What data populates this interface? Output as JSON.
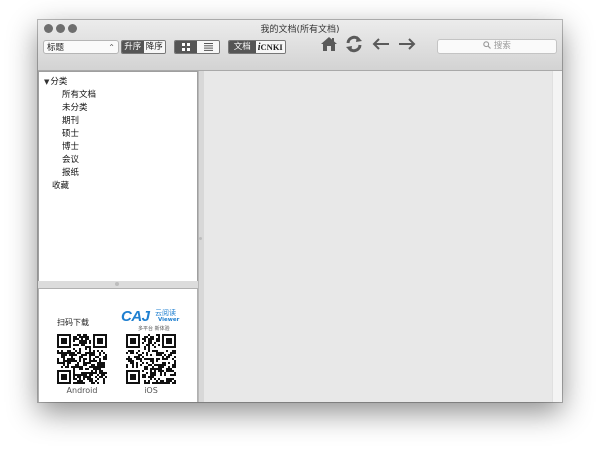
{
  "window": {
    "title": "我的文档(所有文档)"
  },
  "toolbar": {
    "sort_field": "标题",
    "sort_order": {
      "asc_label": "升序",
      "desc_label": "降序",
      "selected": "升序"
    },
    "view_mode": {
      "selected": "grid"
    },
    "source": {
      "doc_label": "文档",
      "cnki_label": "CNKI",
      "cnki_prefix": "i",
      "selected": "文档"
    },
    "search": {
      "placeholder": "搜索"
    }
  },
  "sidebar": {
    "root_label": "分类",
    "items": [
      {
        "label": "所有文档"
      },
      {
        "label": "未分类"
      },
      {
        "label": "期刊"
      },
      {
        "label": "硕士"
      },
      {
        "label": "博士"
      },
      {
        "label": "会议"
      },
      {
        "label": "报纸"
      }
    ],
    "favorites_label": "收藏"
  },
  "promo": {
    "scan_label": "扫码下载",
    "brand": "CAJ",
    "brand_cn": "云阅读",
    "brand_sub": "Viewer",
    "tagline": "多平台 新体验",
    "android_label": "Android",
    "ios_label": "iOS"
  },
  "colors": {
    "accent": "#1e7fd0",
    "toolbar_icon": "#555555",
    "selected_segment": "#555555"
  }
}
